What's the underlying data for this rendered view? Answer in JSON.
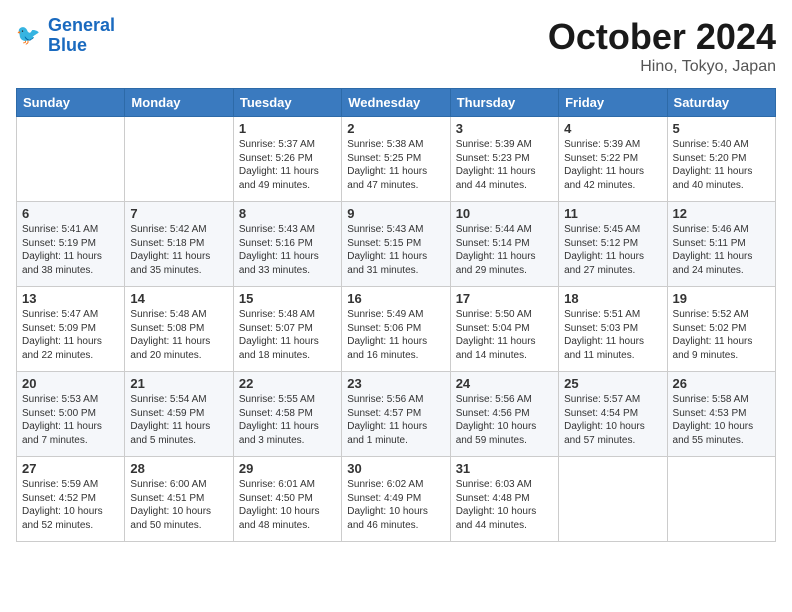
{
  "header": {
    "logo_line1": "General",
    "logo_line2": "Blue",
    "month": "October 2024",
    "location": "Hino, Tokyo, Japan"
  },
  "weekdays": [
    "Sunday",
    "Monday",
    "Tuesday",
    "Wednesday",
    "Thursday",
    "Friday",
    "Saturday"
  ],
  "weeks": [
    [
      {
        "day": "",
        "sunrise": "",
        "sunset": "",
        "daylight": ""
      },
      {
        "day": "",
        "sunrise": "",
        "sunset": "",
        "daylight": ""
      },
      {
        "day": "1",
        "sunrise": "Sunrise: 5:37 AM",
        "sunset": "Sunset: 5:26 PM",
        "daylight": "Daylight: 11 hours and 49 minutes."
      },
      {
        "day": "2",
        "sunrise": "Sunrise: 5:38 AM",
        "sunset": "Sunset: 5:25 PM",
        "daylight": "Daylight: 11 hours and 47 minutes."
      },
      {
        "day": "3",
        "sunrise": "Sunrise: 5:39 AM",
        "sunset": "Sunset: 5:23 PM",
        "daylight": "Daylight: 11 hours and 44 minutes."
      },
      {
        "day": "4",
        "sunrise": "Sunrise: 5:39 AM",
        "sunset": "Sunset: 5:22 PM",
        "daylight": "Daylight: 11 hours and 42 minutes."
      },
      {
        "day": "5",
        "sunrise": "Sunrise: 5:40 AM",
        "sunset": "Sunset: 5:20 PM",
        "daylight": "Daylight: 11 hours and 40 minutes."
      }
    ],
    [
      {
        "day": "6",
        "sunrise": "Sunrise: 5:41 AM",
        "sunset": "Sunset: 5:19 PM",
        "daylight": "Daylight: 11 hours and 38 minutes."
      },
      {
        "day": "7",
        "sunrise": "Sunrise: 5:42 AM",
        "sunset": "Sunset: 5:18 PM",
        "daylight": "Daylight: 11 hours and 35 minutes."
      },
      {
        "day": "8",
        "sunrise": "Sunrise: 5:43 AM",
        "sunset": "Sunset: 5:16 PM",
        "daylight": "Daylight: 11 hours and 33 minutes."
      },
      {
        "day": "9",
        "sunrise": "Sunrise: 5:43 AM",
        "sunset": "Sunset: 5:15 PM",
        "daylight": "Daylight: 11 hours and 31 minutes."
      },
      {
        "day": "10",
        "sunrise": "Sunrise: 5:44 AM",
        "sunset": "Sunset: 5:14 PM",
        "daylight": "Daylight: 11 hours and 29 minutes."
      },
      {
        "day": "11",
        "sunrise": "Sunrise: 5:45 AM",
        "sunset": "Sunset: 5:12 PM",
        "daylight": "Daylight: 11 hours and 27 minutes."
      },
      {
        "day": "12",
        "sunrise": "Sunrise: 5:46 AM",
        "sunset": "Sunset: 5:11 PM",
        "daylight": "Daylight: 11 hours and 24 minutes."
      }
    ],
    [
      {
        "day": "13",
        "sunrise": "Sunrise: 5:47 AM",
        "sunset": "Sunset: 5:09 PM",
        "daylight": "Daylight: 11 hours and 22 minutes."
      },
      {
        "day": "14",
        "sunrise": "Sunrise: 5:48 AM",
        "sunset": "Sunset: 5:08 PM",
        "daylight": "Daylight: 11 hours and 20 minutes."
      },
      {
        "day": "15",
        "sunrise": "Sunrise: 5:48 AM",
        "sunset": "Sunset: 5:07 PM",
        "daylight": "Daylight: 11 hours and 18 minutes."
      },
      {
        "day": "16",
        "sunrise": "Sunrise: 5:49 AM",
        "sunset": "Sunset: 5:06 PM",
        "daylight": "Daylight: 11 hours and 16 minutes."
      },
      {
        "day": "17",
        "sunrise": "Sunrise: 5:50 AM",
        "sunset": "Sunset: 5:04 PM",
        "daylight": "Daylight: 11 hours and 14 minutes."
      },
      {
        "day": "18",
        "sunrise": "Sunrise: 5:51 AM",
        "sunset": "Sunset: 5:03 PM",
        "daylight": "Daylight: 11 hours and 11 minutes."
      },
      {
        "day": "19",
        "sunrise": "Sunrise: 5:52 AM",
        "sunset": "Sunset: 5:02 PM",
        "daylight": "Daylight: 11 hours and 9 minutes."
      }
    ],
    [
      {
        "day": "20",
        "sunrise": "Sunrise: 5:53 AM",
        "sunset": "Sunset: 5:00 PM",
        "daylight": "Daylight: 11 hours and 7 minutes."
      },
      {
        "day": "21",
        "sunrise": "Sunrise: 5:54 AM",
        "sunset": "Sunset: 4:59 PM",
        "daylight": "Daylight: 11 hours and 5 minutes."
      },
      {
        "day": "22",
        "sunrise": "Sunrise: 5:55 AM",
        "sunset": "Sunset: 4:58 PM",
        "daylight": "Daylight: 11 hours and 3 minutes."
      },
      {
        "day": "23",
        "sunrise": "Sunrise: 5:56 AM",
        "sunset": "Sunset: 4:57 PM",
        "daylight": "Daylight: 11 hours and 1 minute."
      },
      {
        "day": "24",
        "sunrise": "Sunrise: 5:56 AM",
        "sunset": "Sunset: 4:56 PM",
        "daylight": "Daylight: 10 hours and 59 minutes."
      },
      {
        "day": "25",
        "sunrise": "Sunrise: 5:57 AM",
        "sunset": "Sunset: 4:54 PM",
        "daylight": "Daylight: 10 hours and 57 minutes."
      },
      {
        "day": "26",
        "sunrise": "Sunrise: 5:58 AM",
        "sunset": "Sunset: 4:53 PM",
        "daylight": "Daylight: 10 hours and 55 minutes."
      }
    ],
    [
      {
        "day": "27",
        "sunrise": "Sunrise: 5:59 AM",
        "sunset": "Sunset: 4:52 PM",
        "daylight": "Daylight: 10 hours and 52 minutes."
      },
      {
        "day": "28",
        "sunrise": "Sunrise: 6:00 AM",
        "sunset": "Sunset: 4:51 PM",
        "daylight": "Daylight: 10 hours and 50 minutes."
      },
      {
        "day": "29",
        "sunrise": "Sunrise: 6:01 AM",
        "sunset": "Sunset: 4:50 PM",
        "daylight": "Daylight: 10 hours and 48 minutes."
      },
      {
        "day": "30",
        "sunrise": "Sunrise: 6:02 AM",
        "sunset": "Sunset: 4:49 PM",
        "daylight": "Daylight: 10 hours and 46 minutes."
      },
      {
        "day": "31",
        "sunrise": "Sunrise: 6:03 AM",
        "sunset": "Sunset: 4:48 PM",
        "daylight": "Daylight: 10 hours and 44 minutes."
      },
      {
        "day": "",
        "sunrise": "",
        "sunset": "",
        "daylight": ""
      },
      {
        "day": "",
        "sunrise": "",
        "sunset": "",
        "daylight": ""
      }
    ]
  ]
}
